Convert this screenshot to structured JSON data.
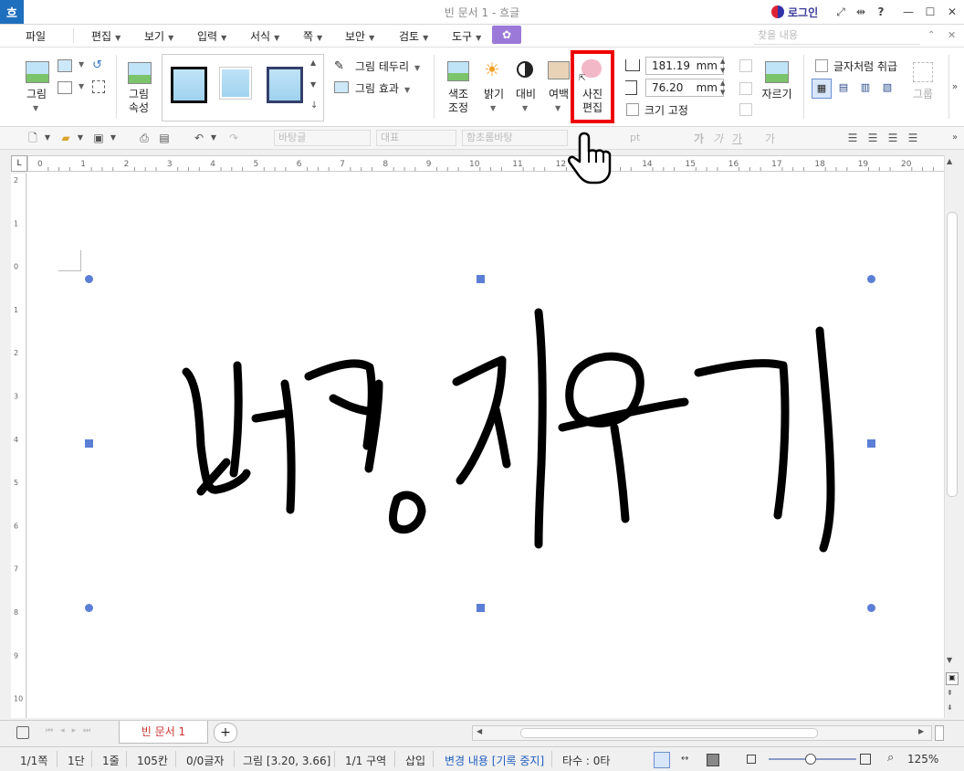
{
  "window": {
    "title": "빈 문서 1 - 흐글",
    "app_logo": "흐",
    "login": "로그인",
    "help": "?",
    "controls": [
      "—",
      "☐",
      "✕"
    ]
  },
  "menu": {
    "items": [
      "파일",
      "편집",
      "보기",
      "입력",
      "서식",
      "쪽",
      "보안",
      "검토",
      "도구"
    ],
    "find_placeholder": "찾을 내용"
  },
  "ribbon": {
    "picture": "그림",
    "picture_props_line1": "그림",
    "picture_props_line2": "속성",
    "border": "그림 테두리",
    "effect": "그림 효과",
    "color_adjust_line1": "색조",
    "color_adjust_line2": "조정",
    "brightness": "밝기",
    "contrast": "대비",
    "margin": "여백",
    "photo_edit_line1": "사진",
    "photo_edit_line2": "편집",
    "width_value": "181.19",
    "height_value": "76.20",
    "unit": "mm",
    "fix_size": "크기 고정",
    "crop": "자르기",
    "treat_as_char": "글자처럼 취급",
    "group": "그룹"
  },
  "format_toolbar": {
    "style": "바탕글",
    "lang": "대표",
    "font": "함초롬바탕",
    "size_unit": "pt",
    "bold": "가",
    "italic": "가",
    "underline": "가",
    "strike": "가"
  },
  "document": {
    "handwriting_text": "배경지우기"
  },
  "tabs": {
    "doc_tab": "빈 문서 1",
    "add": "+"
  },
  "status": {
    "page": "1/1쪽",
    "column": "1단",
    "line": "1줄",
    "col_pos": "105칸",
    "chars": "0/0글자",
    "object": "그림 [3.20, 3.66]",
    "section": "1/1 구역",
    "insert_mode": "삽입",
    "track_changes": "변경 내용 [기록 중지]",
    "typing": "타수 : 0타",
    "zoom": "125%"
  },
  "colors": {
    "highlight": "#ee0000",
    "handle": "#5b7fd6",
    "track_changes": "#1f5fbf",
    "plugin": "#9b79d8"
  }
}
